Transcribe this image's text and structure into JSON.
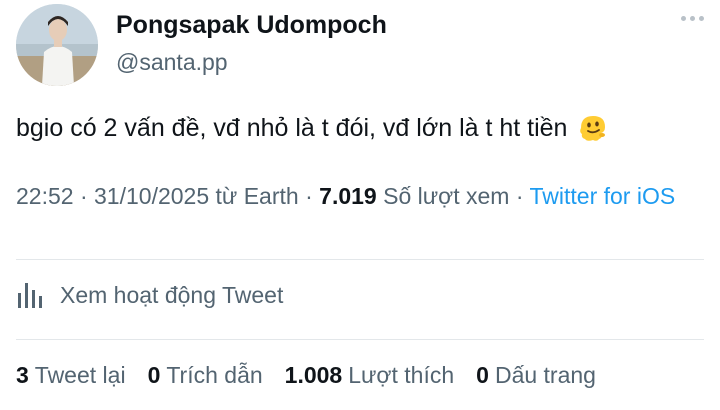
{
  "author": {
    "display_name": "Pongsapak Udompoch",
    "handle": "@santa.pp"
  },
  "tweet": {
    "text": "bgio có 2 vấn đề, vđ nhỏ là t đói, vđ lớn là t ht tiền",
    "emoji": "melting-face"
  },
  "meta": {
    "time": "22:52",
    "date": "31/10/2025",
    "from_word": "từ",
    "location": "Earth",
    "separator": "·",
    "views_count": "7.019",
    "views_label": "Số lượt xem",
    "source": "Twitter for iOS"
  },
  "activity": {
    "label": "Xem hoạt động Tweet",
    "icon": "analytics-bars-icon"
  },
  "stats": [
    {
      "count": "3",
      "label": "Tweet lại"
    },
    {
      "count": "0",
      "label": "Trích dẫn"
    },
    {
      "count": "1.008",
      "label": "Lượt thích"
    },
    {
      "count": "0",
      "label": "Dấu trang"
    }
  ],
  "colors": {
    "text_primary": "#0f1419",
    "text_secondary": "#536471",
    "link": "#1d9bf0",
    "divider": "#e3e7ea"
  }
}
